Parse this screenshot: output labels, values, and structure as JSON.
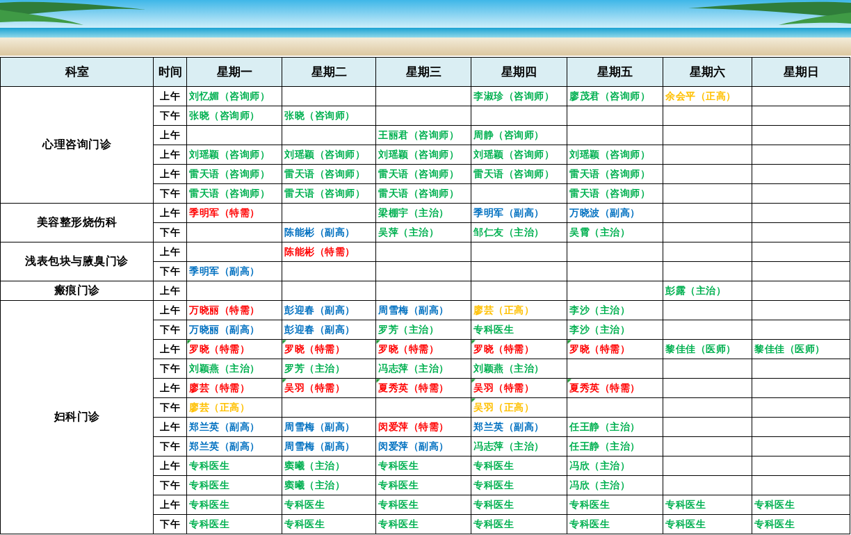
{
  "columns": [
    "科室",
    "时间",
    "星期一",
    "星期二",
    "星期三",
    "星期四",
    "星期五",
    "星期六",
    "星期日"
  ],
  "departments": [
    {
      "name": "心理咨询门诊",
      "rows": [
        {
          "time": "上午",
          "cells": [
            {
              "text": "刘忆媚（咨询师）",
              "color": "#00b050",
              "flagged": false
            },
            null,
            null,
            {
              "text": "李淑珍（咨询师）",
              "color": "#00b050",
              "flagged": false
            },
            {
              "text": "廖茂君（咨询师）",
              "color": "#00b050",
              "flagged": false
            },
            {
              "text": "余会平（正高）",
              "color": "#ffc000",
              "flagged": false
            },
            null
          ]
        },
        {
          "time": "下午",
          "cells": [
            {
              "text": "张晓（咨询师）",
              "color": "#00b050",
              "flagged": false
            },
            {
              "text": "张晓（咨询师）",
              "color": "#00b050",
              "flagged": false
            },
            null,
            null,
            null,
            null,
            null
          ]
        },
        {
          "time": "上午",
          "cells": [
            null,
            null,
            {
              "text": "王丽君（咨询师）",
              "color": "#00b050",
              "flagged": false
            },
            {
              "text": "周静（咨询师）",
              "color": "#00b050",
              "flagged": false
            },
            null,
            null,
            null
          ]
        },
        {
          "time": "上午",
          "cells": [
            {
              "text": "刘瑶颖（咨询师）",
              "color": "#00b050",
              "flagged": false
            },
            {
              "text": "刘瑶颖（咨询师）",
              "color": "#00b050",
              "flagged": false
            },
            {
              "text": "刘瑶颖（咨询师）",
              "color": "#00b050",
              "flagged": false
            },
            {
              "text": "刘瑶颖（咨询师）",
              "color": "#00b050",
              "flagged": false
            },
            {
              "text": "刘瑶颖（咨询师）",
              "color": "#00b050",
              "flagged": false
            },
            null,
            null
          ]
        },
        {
          "time": "上午",
          "cells": [
            {
              "text": "雷天语（咨询师）",
              "color": "#00b050",
              "flagged": false
            },
            {
              "text": "雷天语（咨询师）",
              "color": "#00b050",
              "flagged": false
            },
            {
              "text": "雷天语（咨询师）",
              "color": "#00b050",
              "flagged": false
            },
            {
              "text": "雷天语（咨询师）",
              "color": "#00b050",
              "flagged": false
            },
            {
              "text": "雷天语（咨询师）",
              "color": "#00b050",
              "flagged": false
            },
            null,
            null
          ]
        },
        {
          "time": "下午",
          "cells": [
            {
              "text": "雷天语（咨询师）",
              "color": "#00b050",
              "flagged": false
            },
            {
              "text": "雷天语（咨询师）",
              "color": "#00b050",
              "flagged": false
            },
            {
              "text": "雷天语（咨询师）",
              "color": "#00b050",
              "flagged": false
            },
            null,
            {
              "text": "雷天语（咨询师）",
              "color": "#00b050",
              "flagged": false
            },
            null,
            null
          ]
        }
      ]
    },
    {
      "name": "美容整形烧伤科",
      "rows": [
        {
          "time": "上午",
          "cells": [
            {
              "text": "季明军（特需）",
              "color": "#ff0000",
              "flagged": false
            },
            null,
            {
              "text": "梁棚宇（主治）",
              "color": "#00b050",
              "flagged": false
            },
            {
              "text": "季明军（副高）",
              "color": "#0070c0",
              "flagged": false
            },
            {
              "text": "万晓波（副高）",
              "color": "#0070c0",
              "flagged": false
            },
            null,
            null
          ]
        },
        {
          "time": "下午",
          "cells": [
            null,
            {
              "text": "陈能彬（副高）",
              "color": "#0070c0",
              "flagged": false
            },
            {
              "text": "吴萍（主治）",
              "color": "#00b050",
              "flagged": false
            },
            {
              "text": "邹仁友（主治）",
              "color": "#00b050",
              "flagged": false
            },
            {
              "text": "吴霄（主治）",
              "color": "#00b050",
              "flagged": false
            },
            null,
            null
          ]
        }
      ]
    },
    {
      "name": "浅表包块与腋臭门诊",
      "rows": [
        {
          "time": "上午",
          "cells": [
            null,
            {
              "text": "陈能彬（特需）",
              "color": "#ff0000",
              "flagged": false
            },
            null,
            null,
            null,
            null,
            null
          ]
        },
        {
          "time": "下午",
          "cells": [
            {
              "text": "季明军（副高）",
              "color": "#0070c0",
              "flagged": false
            },
            null,
            null,
            null,
            null,
            null,
            null
          ]
        }
      ]
    },
    {
      "name": "瘢痕门诊",
      "rows": [
        {
          "time": "上午",
          "cells": [
            null,
            null,
            null,
            null,
            null,
            {
              "text": "彭露（主治）",
              "color": "#00b050",
              "flagged": false
            },
            null
          ]
        }
      ]
    },
    {
      "name": "妇科门诊",
      "rows": [
        {
          "time": "上午",
          "cells": [
            {
              "text": "万晓丽（特需）",
              "color": "#ff0000",
              "flagged": false
            },
            {
              "text": "彭迎春（副高）",
              "color": "#0070c0",
              "flagged": false
            },
            {
              "text": "周雪梅（副高）",
              "color": "#0070c0",
              "flagged": false
            },
            {
              "text": "廖芸（正高）",
              "color": "#ffc000",
              "flagged": false
            },
            {
              "text": "李沙（主治）",
              "color": "#00b050",
              "flagged": false
            },
            null,
            null
          ]
        },
        {
          "time": "下午",
          "cells": [
            {
              "text": "万晓丽（副高）",
              "color": "#0070c0",
              "flagged": false
            },
            {
              "text": "彭迎春（副高）",
              "color": "#0070c0",
              "flagged": false
            },
            {
              "text": "罗芳（主治）",
              "color": "#00b050",
              "flagged": false
            },
            {
              "text": "专科医生",
              "color": "#00b050",
              "flagged": false
            },
            {
              "text": "李沙（主治）",
              "color": "#00b050",
              "flagged": false
            },
            null,
            null
          ]
        },
        {
          "time": "上午",
          "cells": [
            {
              "text": "罗晓（特需）",
              "color": "#ff0000",
              "flagged": true
            },
            {
              "text": "罗晓（特需）",
              "color": "#ff0000",
              "flagged": true
            },
            {
              "text": "罗晓（特需）",
              "color": "#ff0000",
              "flagged": true
            },
            {
              "text": "罗晓（特需）",
              "color": "#ff0000",
              "flagged": true
            },
            {
              "text": "罗晓（特需）",
              "color": "#ff0000",
              "flagged": true
            },
            {
              "text": "黎佳佳（医师）",
              "color": "#00b050",
              "flagged": false
            },
            {
              "text": "黎佳佳（医师）",
              "color": "#00b050",
              "flagged": false
            }
          ]
        },
        {
          "time": "下午",
          "cells": [
            {
              "text": "刘颖燕（主治）",
              "color": "#00b050",
              "flagged": false
            },
            {
              "text": "罗芳（主治）",
              "color": "#00b050",
              "flagged": false
            },
            {
              "text": "冯志萍（主治）",
              "color": "#00b050",
              "flagged": false
            },
            {
              "text": "刘颖燕（主治）",
              "color": "#00b050",
              "flagged": false
            },
            null,
            null,
            null
          ]
        },
        {
          "time": "上午",
          "cells": [
            {
              "text": "廖芸（特需）",
              "color": "#ff0000",
              "flagged": false
            },
            {
              "text": "吴羽（特需）",
              "color": "#ff0000",
              "flagged": true
            },
            {
              "text": "夏秀英（特需）",
              "color": "#ff0000",
              "flagged": true
            },
            {
              "text": "吴羽（特需）",
              "color": "#ff0000",
              "flagged": true
            },
            {
              "text": "夏秀英（特需）",
              "color": "#ff0000",
              "flagged": true
            },
            null,
            null
          ]
        },
        {
          "time": "下午",
          "cells": [
            {
              "text": "廖芸（正高）",
              "color": "#ffc000",
              "flagged": false
            },
            null,
            null,
            {
              "text": "吴羽（正高）",
              "color": "#ffc000",
              "flagged": true
            },
            null,
            null,
            null
          ]
        },
        {
          "time": "上午",
          "cells": [
            {
              "text": "郑兰英（副高）",
              "color": "#0070c0",
              "flagged": false
            },
            {
              "text": "周雪梅（副高）",
              "color": "#0070c0",
              "flagged": false
            },
            {
              "text": "闵爱萍（特需）",
              "color": "#ff0000",
              "flagged": false
            },
            {
              "text": "郑兰英（副高）",
              "color": "#0070c0",
              "flagged": false
            },
            {
              "text": "任王静（主治）",
              "color": "#00b050",
              "flagged": false
            },
            null,
            null
          ]
        },
        {
          "time": "下午",
          "cells": [
            {
              "text": "郑兰英（副高）",
              "color": "#0070c0",
              "flagged": false
            },
            {
              "text": "周雪梅（副高）",
              "color": "#0070c0",
              "flagged": false
            },
            {
              "text": "闵爱萍（副高）",
              "color": "#0070c0",
              "flagged": false
            },
            {
              "text": "冯志萍（主治）",
              "color": "#00b050",
              "flagged": false
            },
            {
              "text": "任王静（主治）",
              "color": "#00b050",
              "flagged": false
            },
            null,
            null
          ]
        },
        {
          "time": "上午",
          "cells": [
            {
              "text": "专科医生",
              "color": "#00b050",
              "flagged": false
            },
            {
              "text": "窦曦（主治）",
              "color": "#00b050",
              "flagged": false
            },
            {
              "text": "专科医生",
              "color": "#00b050",
              "flagged": false
            },
            {
              "text": "专科医生",
              "color": "#00b050",
              "flagged": false
            },
            {
              "text": "冯欣（主治）",
              "color": "#00b050",
              "flagged": false
            },
            null,
            null
          ]
        },
        {
          "time": "下午",
          "cells": [
            {
              "text": "专科医生",
              "color": "#00b050",
              "flagged": false
            },
            {
              "text": "窦曦（主治）",
              "color": "#00b050",
              "flagged": false
            },
            {
              "text": "专科医生",
              "color": "#00b050",
              "flagged": false
            },
            {
              "text": "专科医生",
              "color": "#00b050",
              "flagged": false
            },
            {
              "text": "冯欣（主治）",
              "color": "#00b050",
              "flagged": false
            },
            null,
            null
          ]
        },
        {
          "time": "上午",
          "cells": [
            {
              "text": "专科医生",
              "color": "#00b050",
              "flagged": false
            },
            {
              "text": "专科医生",
              "color": "#00b050",
              "flagged": false
            },
            {
              "text": "专科医生",
              "color": "#00b050",
              "flagged": false
            },
            {
              "text": "专科医生",
              "color": "#00b050",
              "flagged": false
            },
            {
              "text": "专科医生",
              "color": "#00b050",
              "flagged": false
            },
            {
              "text": "专科医生",
              "color": "#00b050",
              "flagged": false
            },
            {
              "text": "专科医生",
              "color": "#00b050",
              "flagged": false
            }
          ]
        },
        {
          "time": "下午",
          "cells": [
            {
              "text": "专科医生",
              "color": "#00b050",
              "flagged": false
            },
            {
              "text": "专科医生",
              "color": "#00b050",
              "flagged": false
            },
            {
              "text": "专科医生",
              "color": "#00b050",
              "flagged": false
            },
            {
              "text": "专科医生",
              "color": "#00b050",
              "flagged": false
            },
            {
              "text": "专科医生",
              "color": "#00b050",
              "flagged": false
            },
            {
              "text": "专科医生",
              "color": "#00b050",
              "flagged": false
            },
            {
              "text": "专科医生",
              "color": "#00b050",
              "flagged": false
            }
          ]
        }
      ]
    }
  ]
}
